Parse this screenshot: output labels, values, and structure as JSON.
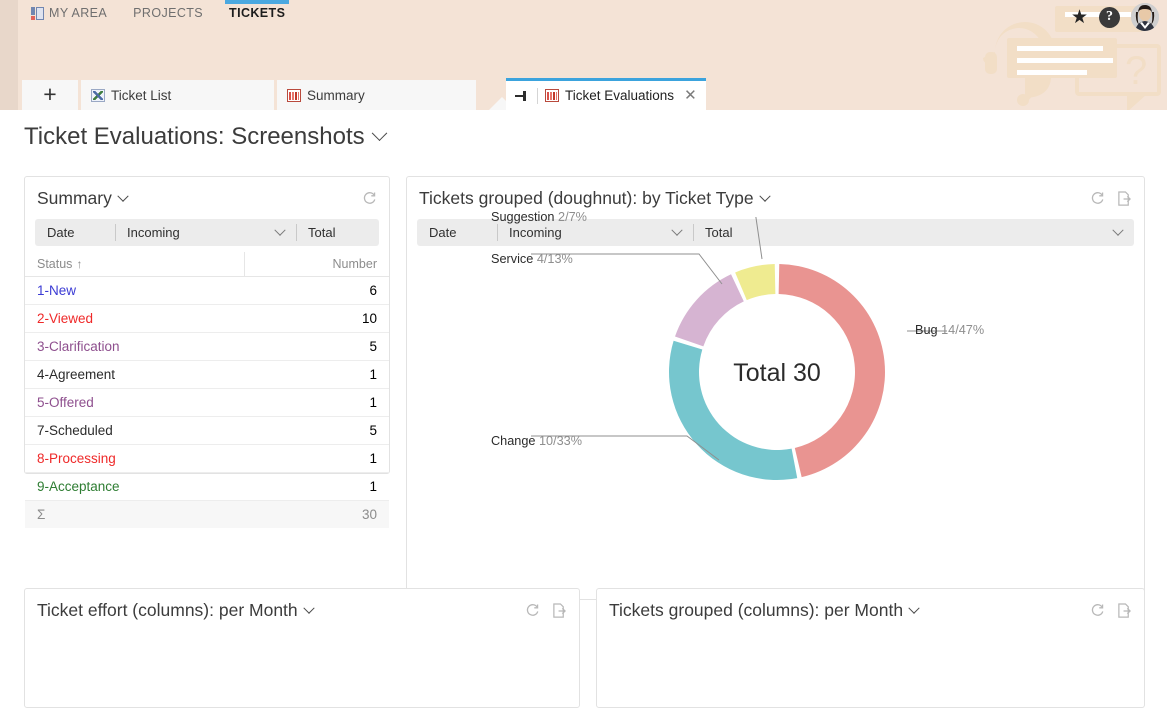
{
  "topnav": {
    "items": [
      {
        "label": "MY AREA",
        "icon": "myarea-icon",
        "active": false
      },
      {
        "label": "PROJECTS",
        "icon": "",
        "active": false
      },
      {
        "label": "TICKETS",
        "icon": "",
        "active": true
      }
    ],
    "star_icon": "star-icon",
    "help_icon": "question-mark-icon",
    "help_label": "?",
    "star_label": "★",
    "avatar": "user-avatar"
  },
  "tabs": {
    "add_label": "+",
    "items": [
      {
        "label": "Ticket List",
        "icon": "tools-icon",
        "active": false
      },
      {
        "label": "Summary",
        "icon": "chart-icon",
        "active": false
      }
    ],
    "active_tab": {
      "label": "Ticket Evaluations",
      "icon": "chart-icon",
      "pin_icon": "pin-icon",
      "close_label": "✕"
    }
  },
  "page": {
    "title": "Ticket Evaluations: Screenshots"
  },
  "summary_card": {
    "title": "Summary",
    "refresh_icon": "refresh-icon",
    "filters": [
      {
        "label": "Date",
        "dropdown": false
      },
      {
        "label": "Incoming",
        "dropdown": true
      },
      {
        "label": "Total",
        "dropdown": false
      }
    ],
    "table": {
      "col_status": "Status",
      "sort_arrow": "↑",
      "col_number": "Number",
      "rows": [
        {
          "status": "1-New",
          "number": "6",
          "color": "#3b3bd4"
        },
        {
          "status": "2-Viewed",
          "number": "10",
          "color": "#ef2929"
        },
        {
          "status": "3-Clarification",
          "number": "5",
          "color": "#8e4f8e"
        },
        {
          "status": "4-Agreement",
          "number": "1",
          "color": "#2b2b2b"
        },
        {
          "status": "5-Offered",
          "number": "1",
          "color": "#8e4f8e"
        },
        {
          "status": "7-Scheduled",
          "number": "5",
          "color": "#2b2b2b"
        },
        {
          "status": "8-Processing",
          "number": "1",
          "color": "#ef2929"
        },
        {
          "status": "9-Acceptance",
          "number": "1",
          "color": "#2e7d32"
        }
      ],
      "total_symbol": "Σ",
      "total_value": "30"
    }
  },
  "donut_card": {
    "title": "Tickets grouped (doughnut): by Ticket Type",
    "refresh_icon": "refresh-icon",
    "export_icon": "export-icon",
    "filters": [
      {
        "label": "Date",
        "dropdown": false
      },
      {
        "label": "Incoming",
        "dropdown": true
      },
      {
        "label": "Total",
        "dropdown": true
      }
    ],
    "center_label": "Total 30"
  },
  "bottom_cards": [
    {
      "title": "Ticket effort (columns): per Month",
      "refresh_icon": "refresh-icon",
      "export_icon": "export-icon"
    },
    {
      "title": "Tickets grouped (columns): per Month",
      "refresh_icon": "refresh-icon",
      "export_icon": "export-icon"
    }
  ],
  "chart_data": {
    "type": "pie",
    "variant": "doughnut",
    "title": "Tickets grouped (doughnut): by Ticket Type",
    "center_text": "Total 30",
    "total": 30,
    "legend_position": "callout-labels",
    "categories": [
      "Bug",
      "Change",
      "Service",
      "Suggestion"
    ],
    "values": [
      14,
      10,
      4,
      2
    ],
    "percents": [
      47,
      33,
      13,
      7
    ],
    "labels": [
      "Bug 14/47%",
      "Change 10/33%",
      "Service 4/13%",
      "Suggestion 2/7%"
    ],
    "colors": [
      "#e99491",
      "#76c6ce",
      "#d6b4d2",
      "#efeb90"
    ],
    "start_angle_deg": 0,
    "direction": "clockwise"
  }
}
